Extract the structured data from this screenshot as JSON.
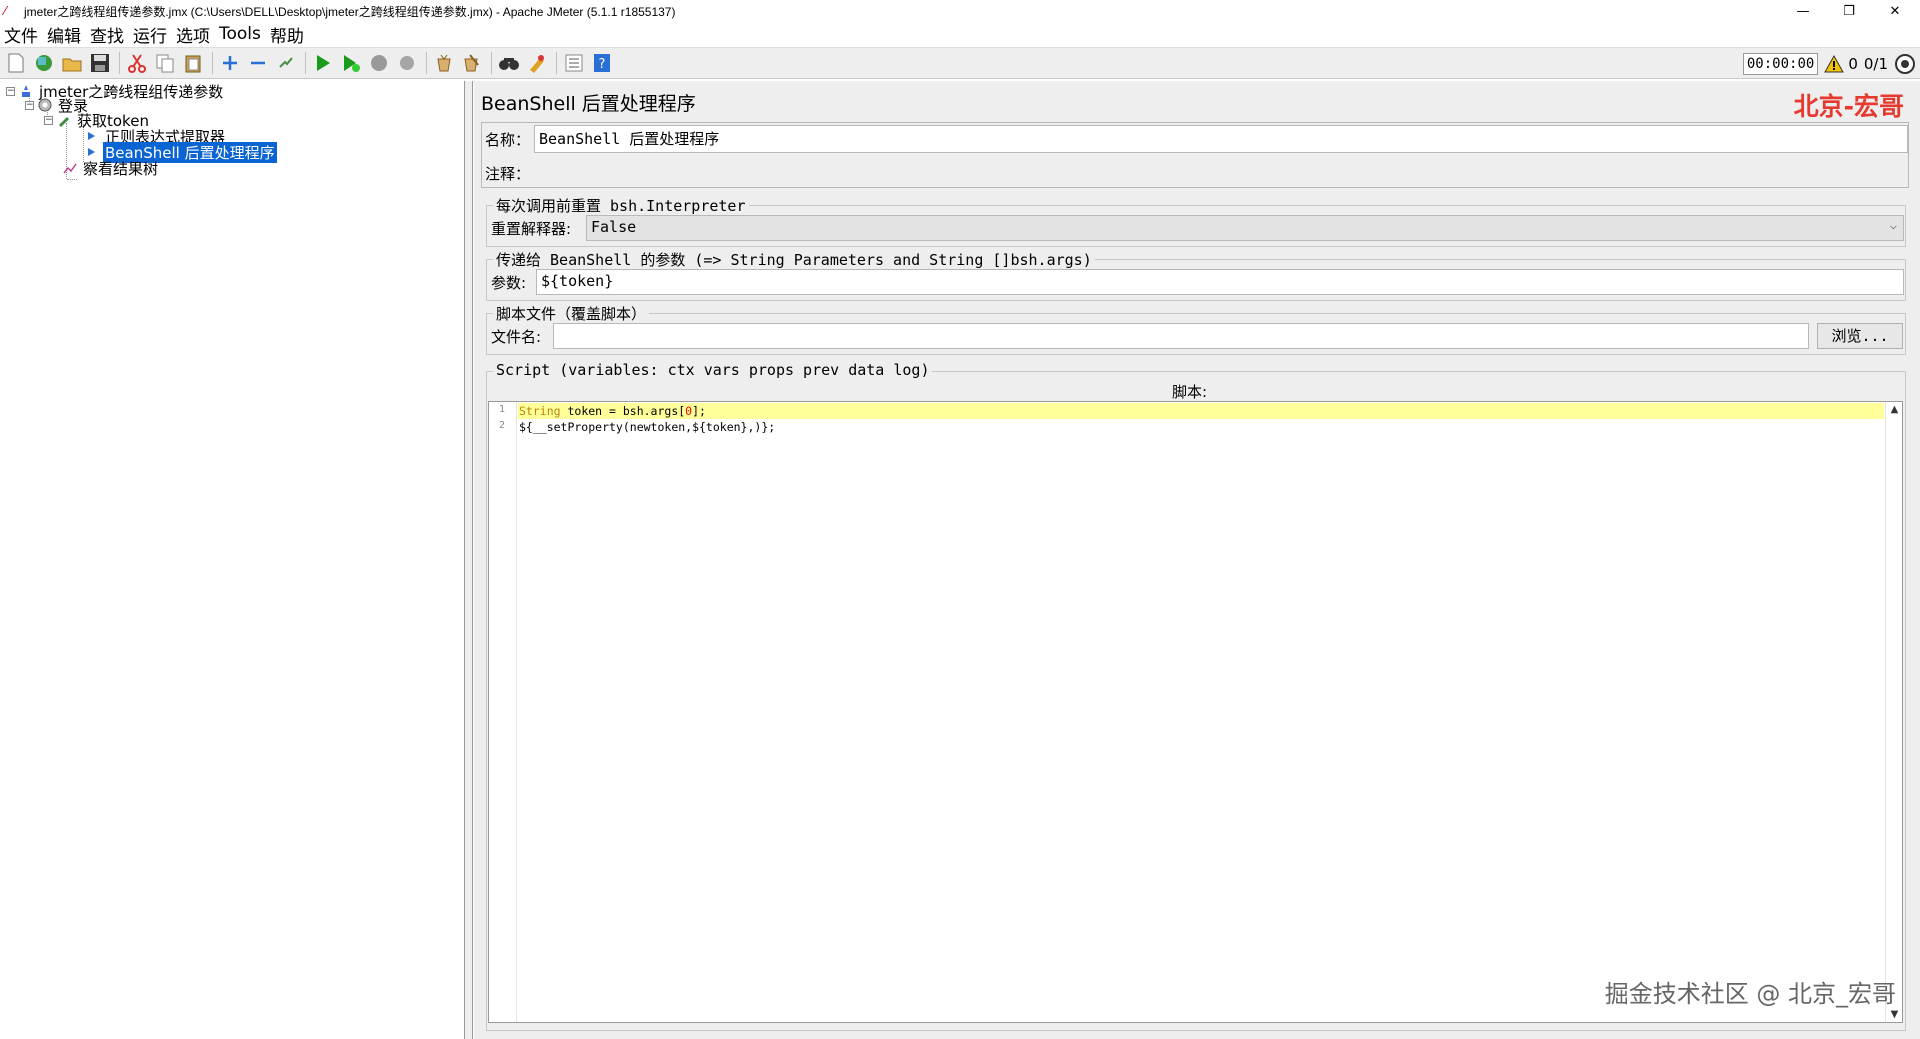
{
  "window": {
    "title": "jmeter之跨线程组传递参数.jmx (C:\\Users\\DELL\\Desktop\\jmeter之跨线程组传递参数.jmx) - Apache JMeter (5.1.1 r1855137)",
    "minimize": "—",
    "restore": "❐",
    "close": "✕"
  },
  "menu": [
    "文件",
    "编辑",
    "查找",
    "运行",
    "选项",
    "Tools",
    "帮助"
  ],
  "toolbar": {
    "timer": "00:00:00",
    "warning_count": "0",
    "threads": "0/1"
  },
  "tree": {
    "root": "jmeter之跨线程组传递参数",
    "thread_group": "登录",
    "sampler": "获取token",
    "extractor": "正则表达式提取器",
    "postprocessor": "BeanShell 后置处理程序",
    "listener": "察看结果树"
  },
  "panel": {
    "title": "BeanShell 后置处理程序",
    "watermark_top": "北京-宏哥",
    "name_label": "名称：",
    "name_value": "BeanShell 后置处理程序",
    "comment_label": "注释：",
    "comment_value": "",
    "reset_group_legend": "每次调用前重置 bsh.Interpreter",
    "reset_label": "重置解释器:",
    "reset_value": "False",
    "params_group_legend": "传递给 BeanShell 的参数 (=> String Parameters and String []bsh.args)",
    "params_label": "参数:",
    "params_value": "${token}",
    "file_group_legend": "脚本文件（覆盖脚本）",
    "file_label": "文件名:",
    "file_value": "",
    "browse_button": "浏览...",
    "script_group_legend": "Script (variables: ctx vars props prev data log)",
    "script_label": "脚本:",
    "watermark_bottom": "掘金技术社区 @ 北京_宏哥"
  },
  "script": {
    "line_numbers": [
      "1",
      "2"
    ],
    "line1": {
      "kw": "String",
      "rest1": " token = bsh.args[",
      "num": "0",
      "rest2": "];"
    },
    "line2": {
      "pre": "${__setProperty(newtoken,${token},)};"
    }
  }
}
